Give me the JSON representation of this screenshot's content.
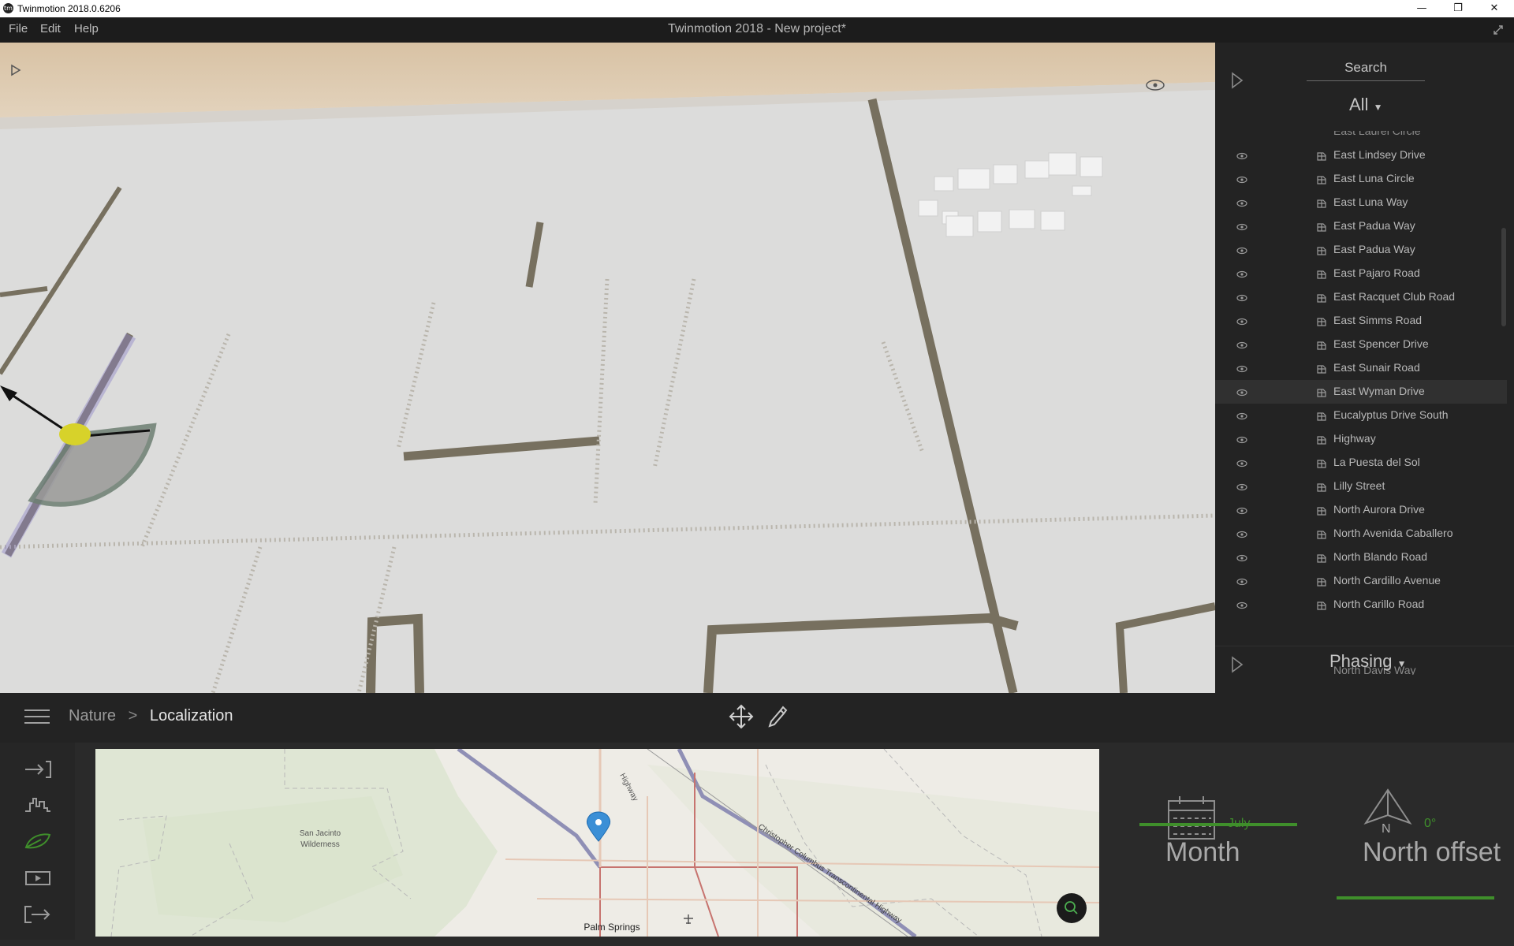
{
  "window": {
    "title": "Twinmotion 2018.0.6206",
    "app_icon": "twinmotion-logo-icon",
    "controls": {
      "minimize": "—",
      "maximize": "❐",
      "close": "✕"
    }
  },
  "menubar": {
    "items": [
      "File",
      "Edit",
      "Help"
    ],
    "document_title": "Twinmotion 2018 - New project*",
    "fullscreen_icon": "expand-icon"
  },
  "right_panel": {
    "search_label": "Search",
    "filter_value": "All",
    "partial_top_item": "East Laurel Circle",
    "items": [
      {
        "label": "East Lindsey Drive"
      },
      {
        "label": "East Luna Circle"
      },
      {
        "label": "East Luna Way"
      },
      {
        "label": "East Padua Way"
      },
      {
        "label": "East Padua Way"
      },
      {
        "label": "East Pajaro Road"
      },
      {
        "label": "East Racquet Club Road"
      },
      {
        "label": "East Simms Road"
      },
      {
        "label": "East Spencer Drive"
      },
      {
        "label": "East Sunair Road"
      },
      {
        "label": "East Wyman Drive",
        "selected": true
      },
      {
        "label": "Eucalyptus Drive South"
      },
      {
        "label": "Highway"
      },
      {
        "label": "La Puesta del Sol"
      },
      {
        "label": "Lilly Street"
      },
      {
        "label": "North Aurora Drive"
      },
      {
        "label": "North Avenida Caballero"
      },
      {
        "label": "North Blando Road"
      },
      {
        "label": "North Cardillo Avenue"
      },
      {
        "label": "North Carillo Road"
      }
    ],
    "partial_bottom_item": "North Davis Way",
    "phasing_label": "Phasing"
  },
  "toolbar": {
    "breadcrumb": [
      "Nature",
      "Localization"
    ],
    "separator": ">"
  },
  "map": {
    "labels": {
      "wilderness_line1": "San Jacinto",
      "wilderness_line2": "Wilderness",
      "city": "Palm Springs",
      "highway_top": "Highway",
      "highway_diag": "Christopher Columbus Transcontinental Highway"
    }
  },
  "settings": {
    "month_label": "Month",
    "month_value": "July",
    "north_label": "North offset",
    "north_value": "0°",
    "north_letter": "N",
    "accent_color": "#3f8f2b"
  }
}
